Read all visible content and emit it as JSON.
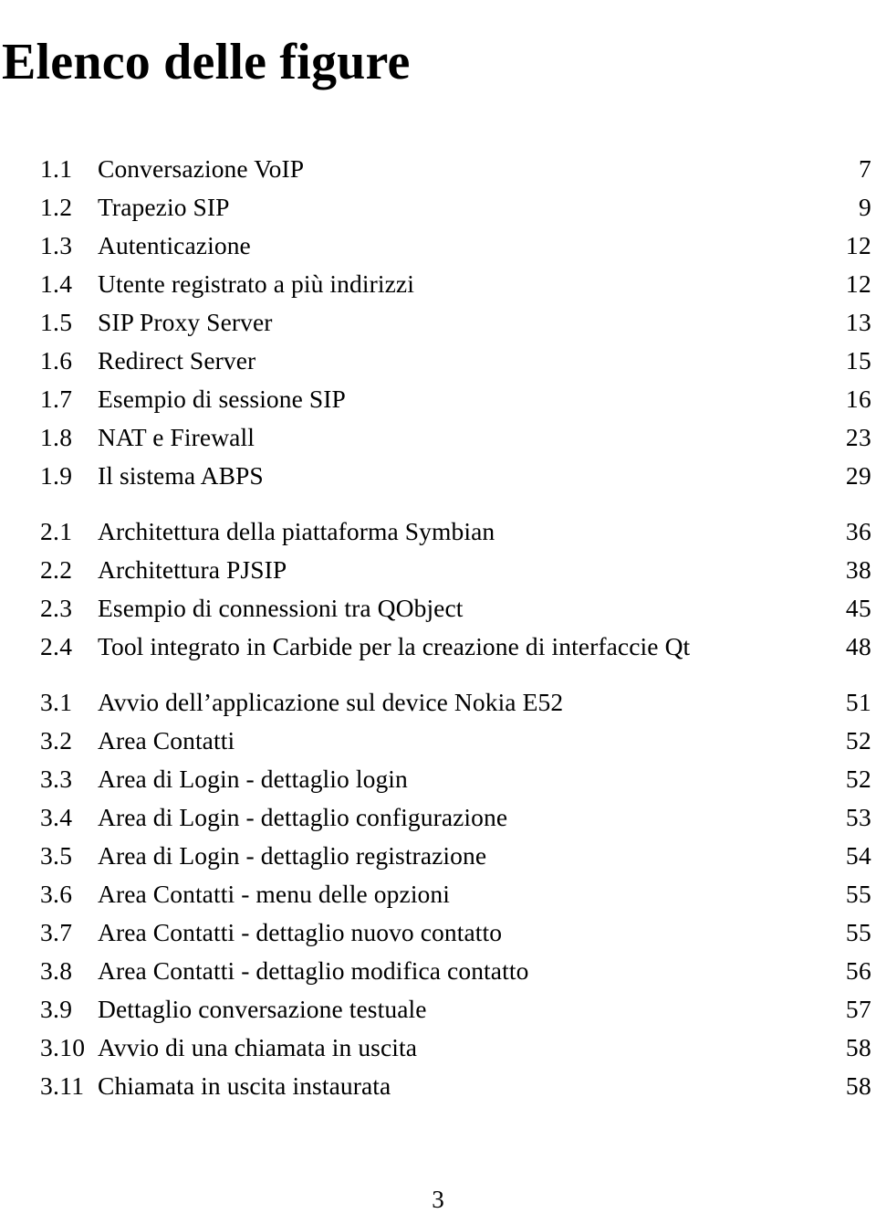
{
  "document": {
    "title": "Elenco delle figure",
    "folio": "3",
    "leader_char": "."
  },
  "list_of_figures": {
    "groups": [
      {
        "chapter": "1",
        "entries": [
          {
            "number": "1.1",
            "label": "Conversazione VoIP",
            "page": "7",
            "leader_dots": 24
          },
          {
            "number": "1.2",
            "label": "Trapezio SIP",
            "page": "9",
            "leader_dots": 26
          },
          {
            "number": "1.3",
            "label": "Autenticazione",
            "page": "12",
            "leader_dots": 26
          },
          {
            "number": "1.4",
            "label": "Utente registrato a più indirizzi",
            "page": "12",
            "leader_dots": 15
          },
          {
            "number": "1.5",
            "label": "SIP Proxy Server",
            "page": "13",
            "leader_dots": 24
          },
          {
            "number": "1.6",
            "label": "Redirect Server",
            "page": "15",
            "leader_dots": 25
          },
          {
            "number": "1.7",
            "label": "Esempio di sessione SIP",
            "page": "16",
            "leader_dots": 20
          },
          {
            "number": "1.8",
            "label": "NAT e Firewall",
            "page": "23",
            "leader_dots": 25
          },
          {
            "number": "1.9",
            "label": "Il sistema ABPS",
            "page": "29",
            "leader_dots": 24
          }
        ]
      },
      {
        "chapter": "2",
        "entries": [
          {
            "number": "2.1",
            "label": "Architettura della piattaforma Symbian",
            "page": "36",
            "leader_dots": 13
          },
          {
            "number": "2.2",
            "label": "Architettura PJSIP",
            "page": "38",
            "leader_dots": 22
          },
          {
            "number": "2.3",
            "label": "Esempio di connessioni tra QObject",
            "page": "45",
            "leader_dots": 15
          },
          {
            "number": "2.4",
            "label": "Tool integrato in Carbide per la creazione di interfaccie Qt",
            "page": "48",
            "leader_dots": 2
          }
        ]
      },
      {
        "chapter": "3",
        "entries": [
          {
            "number": "3.1",
            "label": "Avvio dell’applicazione sul device Nokia E52",
            "page": "51",
            "leader_dots": 10
          },
          {
            "number": "3.2",
            "label": "Area Contatti",
            "page": "52",
            "leader_dots": 22
          },
          {
            "number": "3.3",
            "label": "Area di Login - dettaglio login",
            "page": "52",
            "leader_dots": 17
          },
          {
            "number": "3.4",
            "label": "Area di Login - dettaglio configurazione",
            "page": "53",
            "leader_dots": 13
          },
          {
            "number": "3.5",
            "label": "Area di Login - dettaglio registrazione",
            "page": "54",
            "leader_dots": 13
          },
          {
            "number": "3.6",
            "label": "Area Contatti - menu delle opzioni",
            "page": "55",
            "leader_dots": 15
          },
          {
            "number": "3.7",
            "label": "Area Contatti - dettaglio nuovo contatto",
            "page": "55",
            "leader_dots": 12
          },
          {
            "number": "3.8",
            "label": "Area Contatti - dettaglio modifica contatto",
            "page": "56",
            "leader_dots": 11
          },
          {
            "number": "3.9",
            "label": "Dettaglio conversazione testuale",
            "page": "57",
            "leader_dots": 16
          },
          {
            "number": "3.10",
            "label": "Avvio di una chiamata in uscita",
            "page": "58",
            "leader_dots": 17
          },
          {
            "number": "3.11",
            "label": "Chiamata in uscita instaurata",
            "page": "58",
            "leader_dots": 18
          }
        ]
      }
    ]
  }
}
